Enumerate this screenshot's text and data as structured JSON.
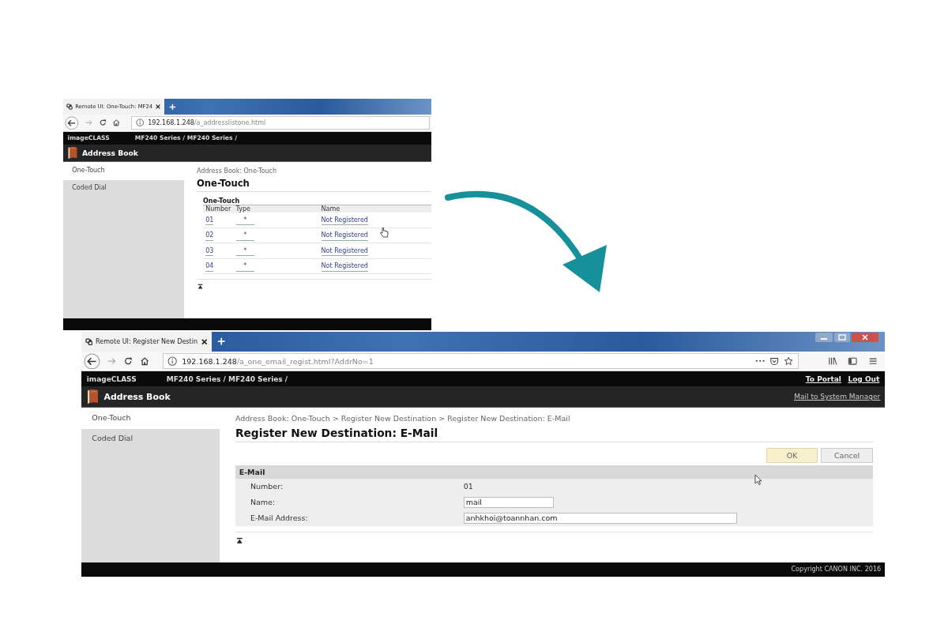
{
  "screens": [
    {
      "kind": "list",
      "full_toolbar": false,
      "tab": {
        "title": "Remote UI: One-Touch: MF24"
      },
      "url": {
        "host": "192.168.1.248",
        "path": "/a_addresslistone.html"
      },
      "header": {
        "brand": "imageCLASS",
        "device": "MF240 Series / MF240 Series /",
        "title": "Address Book"
      },
      "sidebar": [
        {
          "label": "One-Touch",
          "selected": true
        },
        {
          "label": "Coded Dial",
          "selected": false
        }
      ],
      "breadcrumb": "Address Book: One-Touch",
      "heading": "One-Touch",
      "table": {
        "caption": "One-Touch",
        "columns": [
          "Number",
          "Type",
          "Name"
        ],
        "rows": [
          [
            "01",
            "*",
            "Not Registered"
          ],
          [
            "02",
            "*",
            "Not Registered"
          ],
          [
            "03",
            "*",
            "Not Registered"
          ],
          [
            "04",
            "*",
            "Not Registered"
          ]
        ]
      }
    },
    {
      "kind": "form",
      "full_toolbar": true,
      "tab": {
        "title": "Remote UI: Register New Destin"
      },
      "url": {
        "host": "192.168.1.248",
        "path": "/a_one_email_regist.html?AddrNo=1"
      },
      "header": {
        "brand": "imageCLASS",
        "device": "MF240 Series / MF240 Series /",
        "title": "Address Book",
        "top_links": [
          "To Portal",
          "Log Out"
        ],
        "title_link": "Mail to System Manager"
      },
      "sidebar": [
        {
          "label": "One-Touch",
          "selected": true
        },
        {
          "label": "Coded Dial",
          "selected": false
        }
      ],
      "breadcrumb": "Address Book: One-Touch > Register New Destination > Register New Destination: E-Mail",
      "heading": "Register New Destination: E-Mail",
      "buttons": [
        {
          "label": "OK",
          "primary": true
        },
        {
          "label": "Cancel",
          "primary": false
        }
      ],
      "section": {
        "title": "E-Mail",
        "fields": [
          {
            "label": "Number:",
            "kind": "value",
            "value": "01"
          },
          {
            "label": "Name:",
            "kind": "input",
            "wide": false,
            "value": "mail"
          },
          {
            "label": "E-Mail Address:",
            "kind": "input",
            "wide": true,
            "value": "anhkhoi@toannhan.com"
          }
        ]
      },
      "footer": "Copyright CANON INC. 2016"
    }
  ]
}
